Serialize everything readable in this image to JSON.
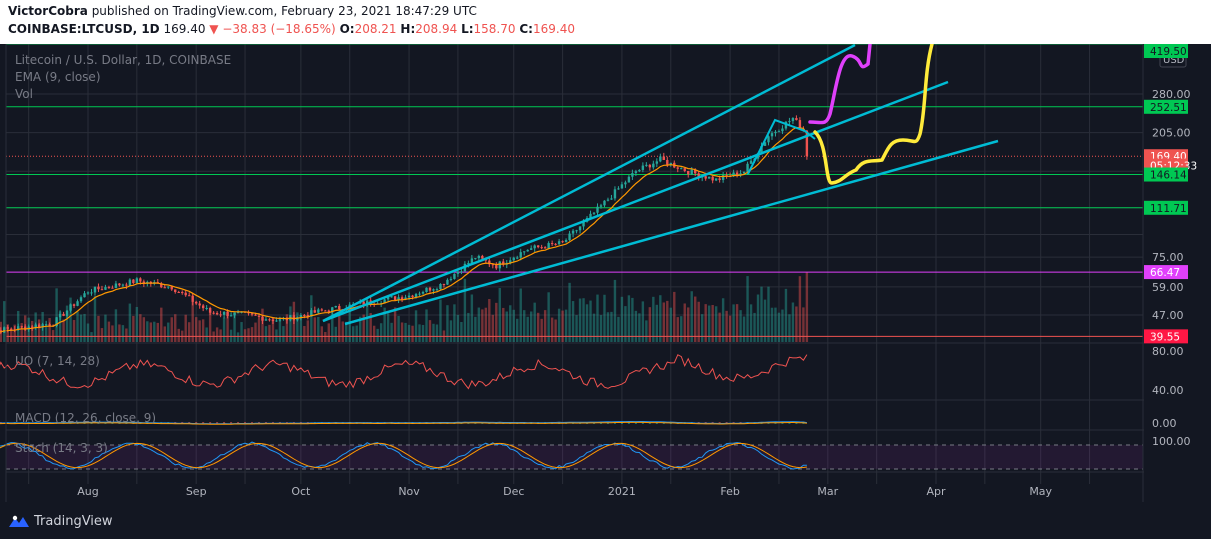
{
  "header": {
    "author": "VictorCobra",
    "published_text": "published on TradingView.com, February 23, 2021 18:47:29 UTC",
    "symbol": "COINBASE:LTCUSD, 1D",
    "last": "169.40",
    "change": "▼ −38.83 (−18.65%)",
    "open_label": "O:",
    "open": "208.21",
    "high_label": "H:",
    "high": "208.94",
    "low_label": "L:",
    "low": "158.70",
    "close_label": "C:",
    "close": "169.40"
  },
  "legend": {
    "title": "Litecoin / U.S. Dollar, 1D, COINBASE",
    "ema": "EMA (9, close)",
    "vol": "Vol",
    "uo": "UO (7, 14, 28)",
    "macd": "MACD (12, 26, close, 9)",
    "stoch": "Stoch (14, 3, 3)"
  },
  "price_axis": {
    "currency": "USD",
    "ticks": [
      "280.00",
      "205.00",
      "75.00",
      "59.00",
      "47.00"
    ],
    "labels": [
      {
        "text": "419.50",
        "color": "#00c853",
        "price": 419.5
      },
      {
        "text": "252.51",
        "color": "#00c853",
        "price": 252.51
      },
      {
        "text": "169.40",
        "color": "#ef5350",
        "price": 169.4
      },
      {
        "text": "05:12:33",
        "color": "#ef5350",
        "price": 157
      },
      {
        "text": "146.14",
        "color": "#00c853",
        "price": 146.14
      },
      {
        "text": "111.71",
        "color": "#00c853",
        "price": 111.71
      },
      {
        "text": "66.47",
        "color": "#e040fb",
        "price": 66.47
      },
      {
        "text": "39.55",
        "color": "#ff1744",
        "price": 39.55
      }
    ]
  },
  "uo_axis": [
    "80.00",
    "40.00"
  ],
  "macd_axis": [
    "0.00"
  ],
  "stoch_axis": [
    "100.00"
  ],
  "time_axis": [
    "Aug",
    "Sep",
    "Oct",
    "Nov",
    "Dec",
    "2021",
    "Feb",
    "Mar",
    "Apr",
    "May"
  ],
  "footer": {
    "brand": "TradingView"
  },
  "colors": {
    "bg": "#131722",
    "up": "#26a69a",
    "down": "#ef5350",
    "ema": "#ff9800",
    "trend": "#00bcd4",
    "level": "#00c853",
    "magenta": "#e040fb",
    "yellow": "#ffeb3b"
  },
  "chart_data": {
    "type": "candlestick",
    "title": "Litecoin / U.S. Dollar, 1D, COINBASE",
    "scale": "log",
    "ylim": [
      38,
      430
    ],
    "x_range": [
      "2020-07-01",
      "2021-05-31"
    ],
    "horizontal_levels": [
      419.5,
      252.51,
      146.14,
      111.71,
      66.47,
      39.55
    ],
    "approx_closes": [
      {
        "date": "2020-07-01",
        "close": 41
      },
      {
        "date": "2020-07-10",
        "close": 42
      },
      {
        "date": "2020-07-22",
        "close": 44
      },
      {
        "date": "2020-08-01",
        "close": 57
      },
      {
        "date": "2020-08-15",
        "close": 62
      },
      {
        "date": "2020-08-25",
        "close": 59
      },
      {
        "date": "2020-09-05",
        "close": 48
      },
      {
        "date": "2020-09-15",
        "close": 47
      },
      {
        "date": "2020-09-25",
        "close": 45
      },
      {
        "date": "2020-10-05",
        "close": 48
      },
      {
        "date": "2020-10-20",
        "close": 52
      },
      {
        "date": "2020-11-01",
        "close": 55
      },
      {
        "date": "2020-11-10",
        "close": 60
      },
      {
        "date": "2020-11-20",
        "close": 75
      },
      {
        "date": "2020-11-26",
        "close": 70
      },
      {
        "date": "2020-12-05",
        "close": 80
      },
      {
        "date": "2020-12-15",
        "close": 84
      },
      {
        "date": "2020-12-25",
        "close": 110
      },
      {
        "date": "2021-01-05",
        "close": 150
      },
      {
        "date": "2021-01-12",
        "close": 165
      },
      {
        "date": "2021-01-20",
        "close": 150
      },
      {
        "date": "2021-01-28",
        "close": 140
      },
      {
        "date": "2021-02-05",
        "close": 150
      },
      {
        "date": "2021-02-12",
        "close": 200
      },
      {
        "date": "2021-02-19",
        "close": 230
      },
      {
        "date": "2021-02-22",
        "close": 208
      },
      {
        "date": "2021-02-23",
        "close": 169.4
      }
    ],
    "indicators": {
      "ultimate_oscillator": {
        "params": "7, 14, 28",
        "approx_range": [
          40,
          80
        ]
      },
      "macd": {
        "params": "12, 26, close, 9"
      },
      "stochastic": {
        "params": "14, 3, 3",
        "approx_range": [
          0,
          100
        ]
      }
    }
  }
}
